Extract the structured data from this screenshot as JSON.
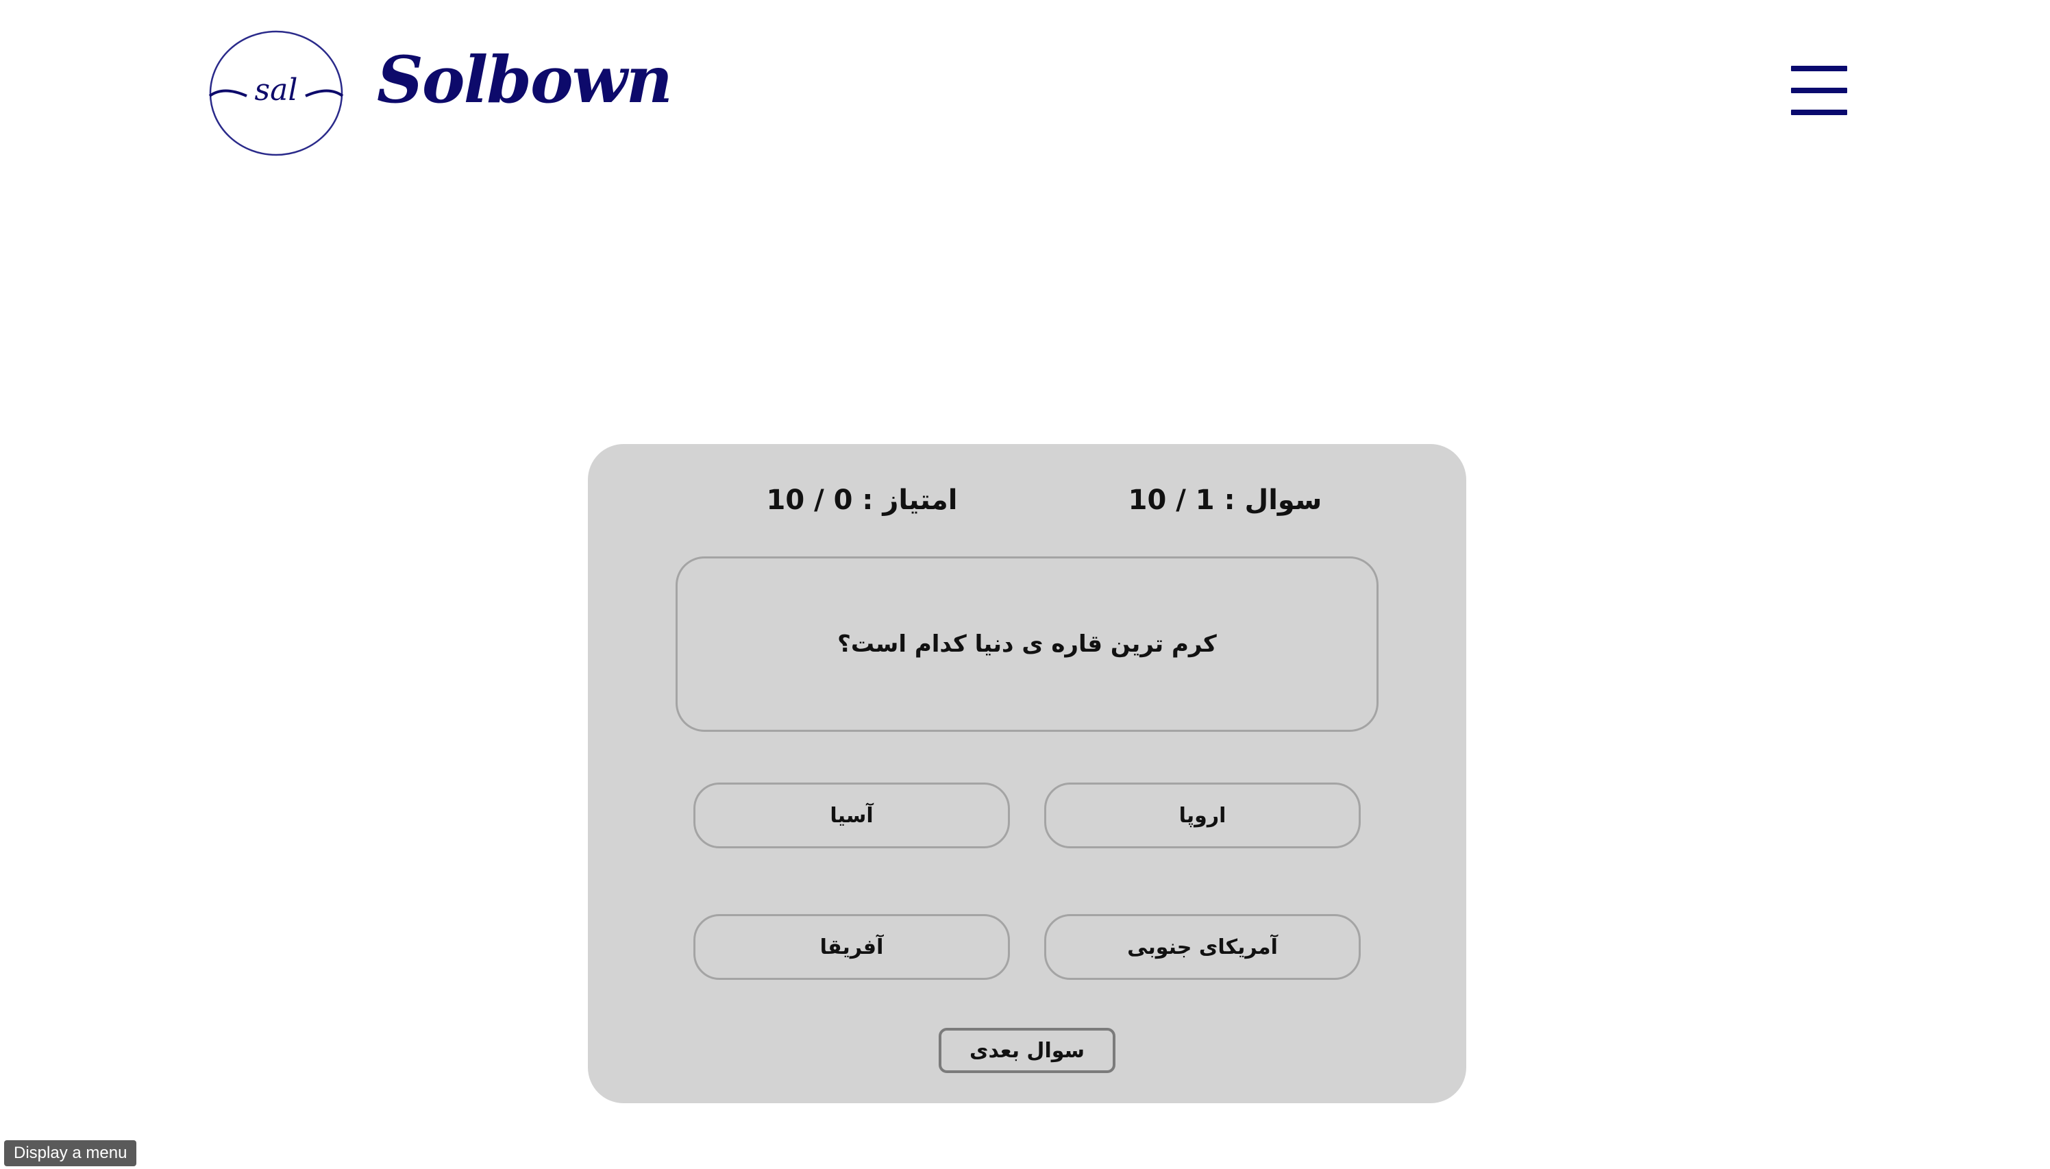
{
  "header": {
    "logo_text": "sal",
    "brand_name": "Solbown",
    "menu_icon": "hamburger-menu-icon"
  },
  "quiz": {
    "question_counter": "سوال : 1 / 10",
    "score": "امتیاز : 0 / 10",
    "question_text": "کرم ترین قاره ی دنیا کدام است؟",
    "options": [
      "اروپا",
      "آسیا",
      "آمریکای جنوبی",
      "آفریقا"
    ],
    "next_button_label": "سوال بعدی"
  },
  "tooltip": {
    "text": "Display a menu"
  },
  "colors": {
    "brand": "#0d0a6b",
    "card_background": "#d3d3d3",
    "border": "#a4a4a4"
  }
}
